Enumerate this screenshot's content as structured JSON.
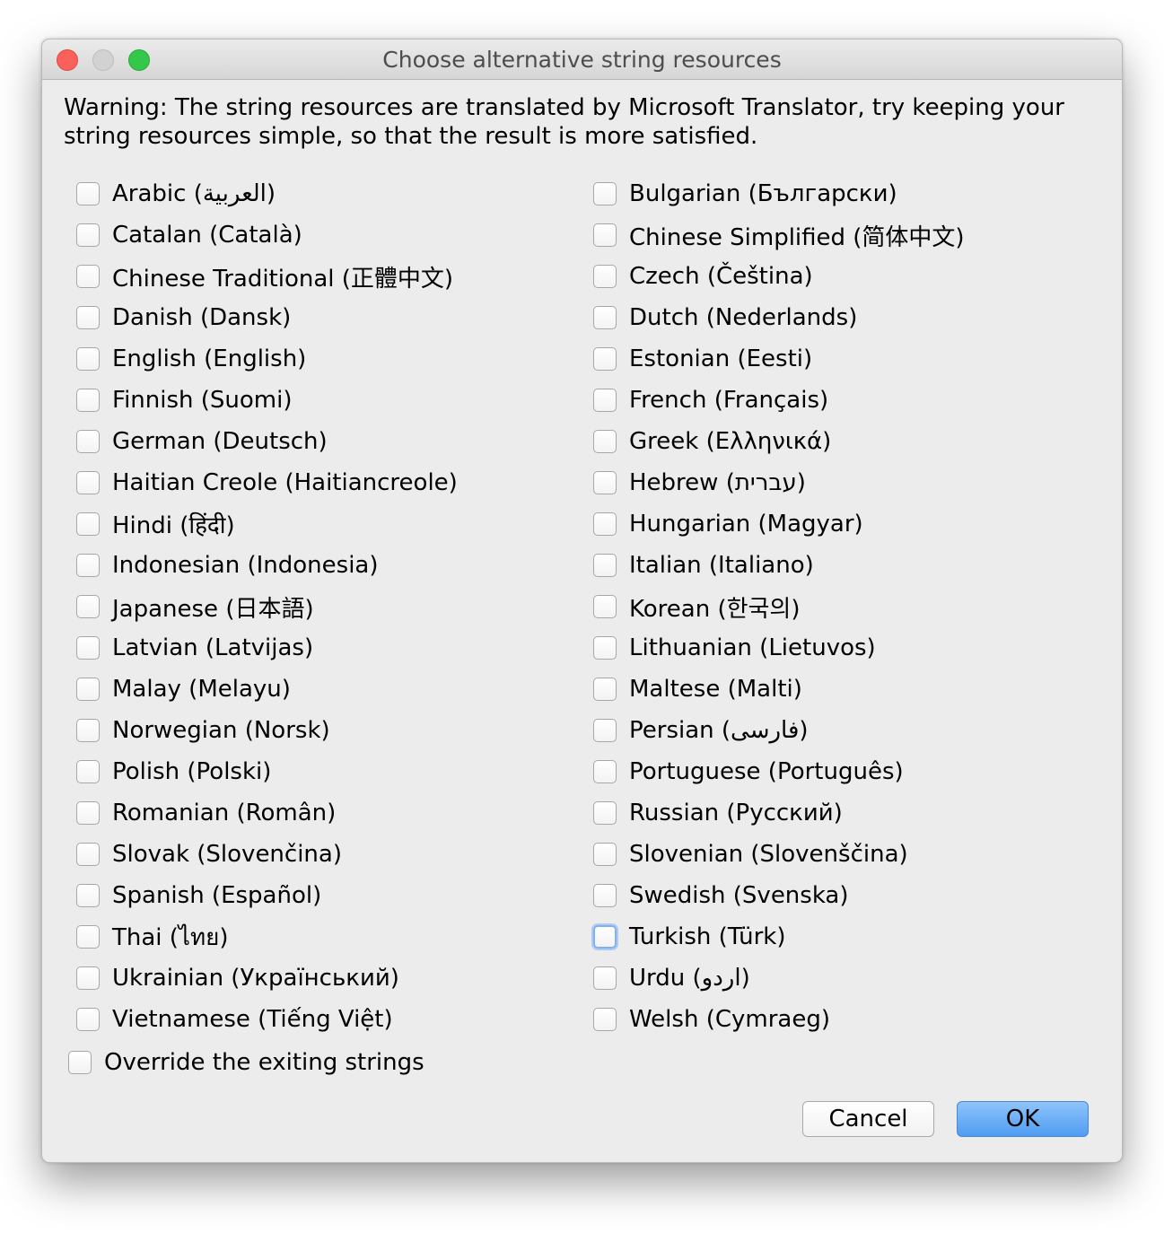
{
  "window": {
    "title": "Choose alternative string resources"
  },
  "warning": "Warning: The string resources are translated by Microsoft Translator, try keeping your string resources simple, so that the result is more satisfied.",
  "languages_left": [
    "Arabic (العربية)",
    "Catalan (Català)",
    "Chinese Traditional (正體中文)",
    "Danish (Dansk)",
    "English (English)",
    "Finnish (Suomi)",
    "German (Deutsch)",
    "Haitian Creole (Haitiancreole)",
    "Hindi (हिंदी)",
    "Indonesian (Indonesia)",
    "Japanese (日本語)",
    "Latvian (Latvijas)",
    "Malay (Melayu)",
    "Norwegian (Norsk)",
    "Polish (Polski)",
    "Romanian (Român)",
    "Slovak (Slovenčina)",
    "Spanish (Español)",
    "Thai (ไทย)",
    "Ukrainian (Український)",
    "Vietnamese (Tiếng Việt)"
  ],
  "languages_right": [
    "Bulgarian (Български)",
    "Chinese Simplified (简体中文)",
    "Czech (Čeština)",
    "Dutch (Nederlands)",
    "Estonian (Eesti)",
    "French (Français)",
    "Greek (Ελληνικά)",
    "Hebrew (עברית)",
    "Hungarian (Magyar)",
    "Italian (Italiano)",
    "Korean (한국의)",
    "Lithuanian (Lietuvos)",
    "Maltese (Malti)",
    "Persian (فارسی)",
    "Portuguese (Português)",
    "Russian (Русский)",
    "Slovenian (Slovenščina)",
    "Swedish (Svenska)",
    "Turkish (Türk)",
    "Urdu (اردو)",
    "Welsh (Cymraeg)"
  ],
  "override_label": "Override the exiting strings",
  "buttons": {
    "cancel": "Cancel",
    "ok": "OK"
  }
}
